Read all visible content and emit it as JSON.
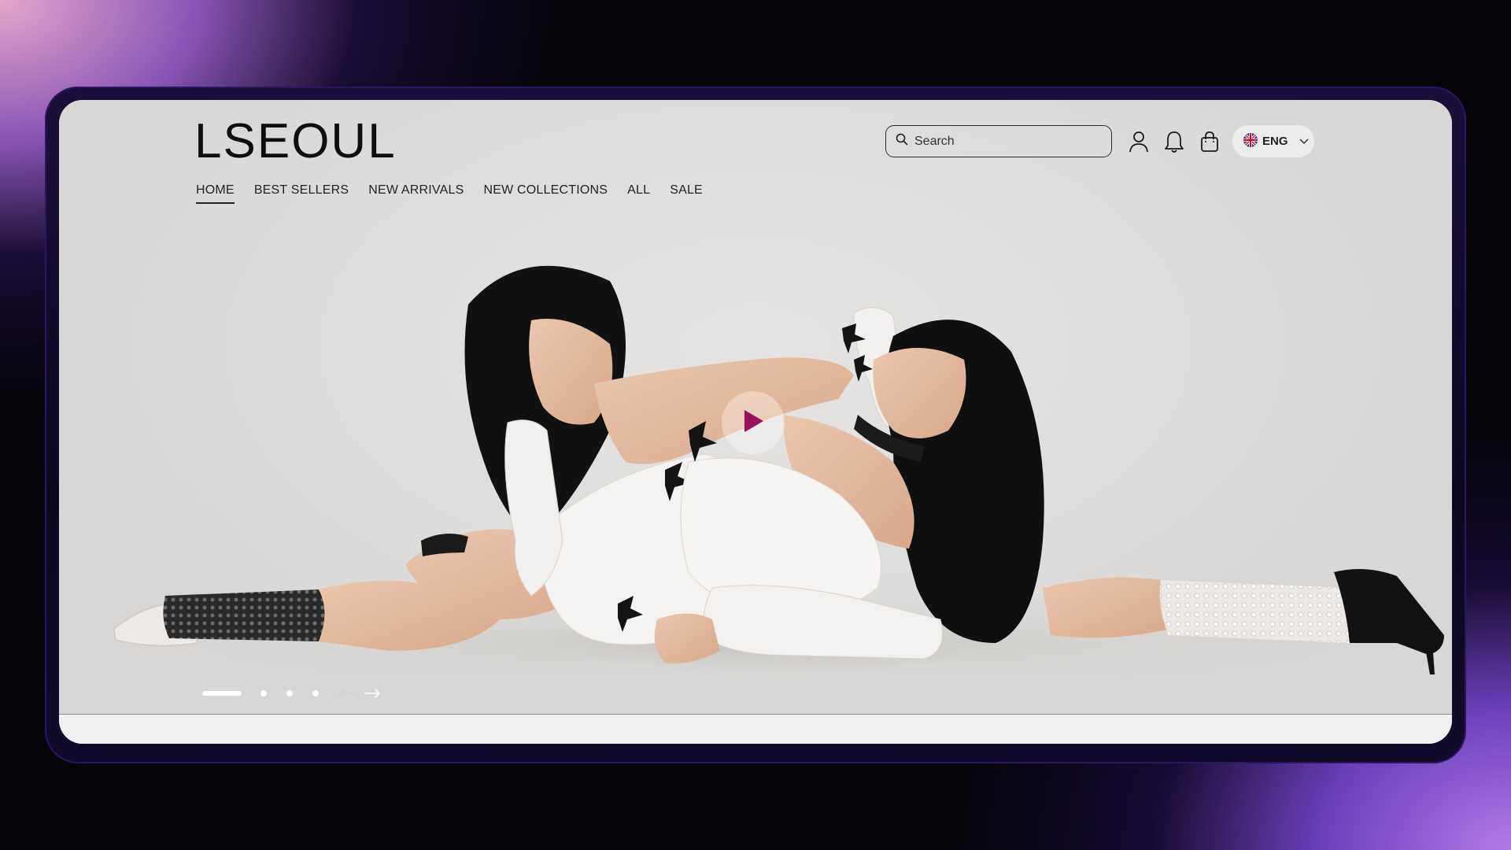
{
  "brand": {
    "logo": "LSEOUL"
  },
  "nav": {
    "items": [
      {
        "label": "HOME",
        "active": true
      },
      {
        "label": "BEST SELLERS",
        "active": false
      },
      {
        "label": "NEW ARRIVALS",
        "active": false
      },
      {
        "label": "NEW COLLECTIONS",
        "active": false
      },
      {
        "label": "ALL",
        "active": false
      },
      {
        "label": "SALE",
        "active": false
      }
    ]
  },
  "header": {
    "search": {
      "placeholder": "Search",
      "value": ""
    },
    "icons": [
      "user-icon",
      "bell-icon",
      "shopping-bag-icon"
    ],
    "language": {
      "code": "ENG",
      "flag": "uk-flag-icon"
    }
  },
  "hero": {
    "play_button": {
      "icon": "play-icon",
      "color": "#9b0f5a"
    },
    "carousel": {
      "total_slides": 4,
      "active_index": 0
    }
  },
  "colors": {
    "accent": "#9b0f5a",
    "text": "#0e0e0e",
    "hero_background": "#e3e2e0"
  }
}
